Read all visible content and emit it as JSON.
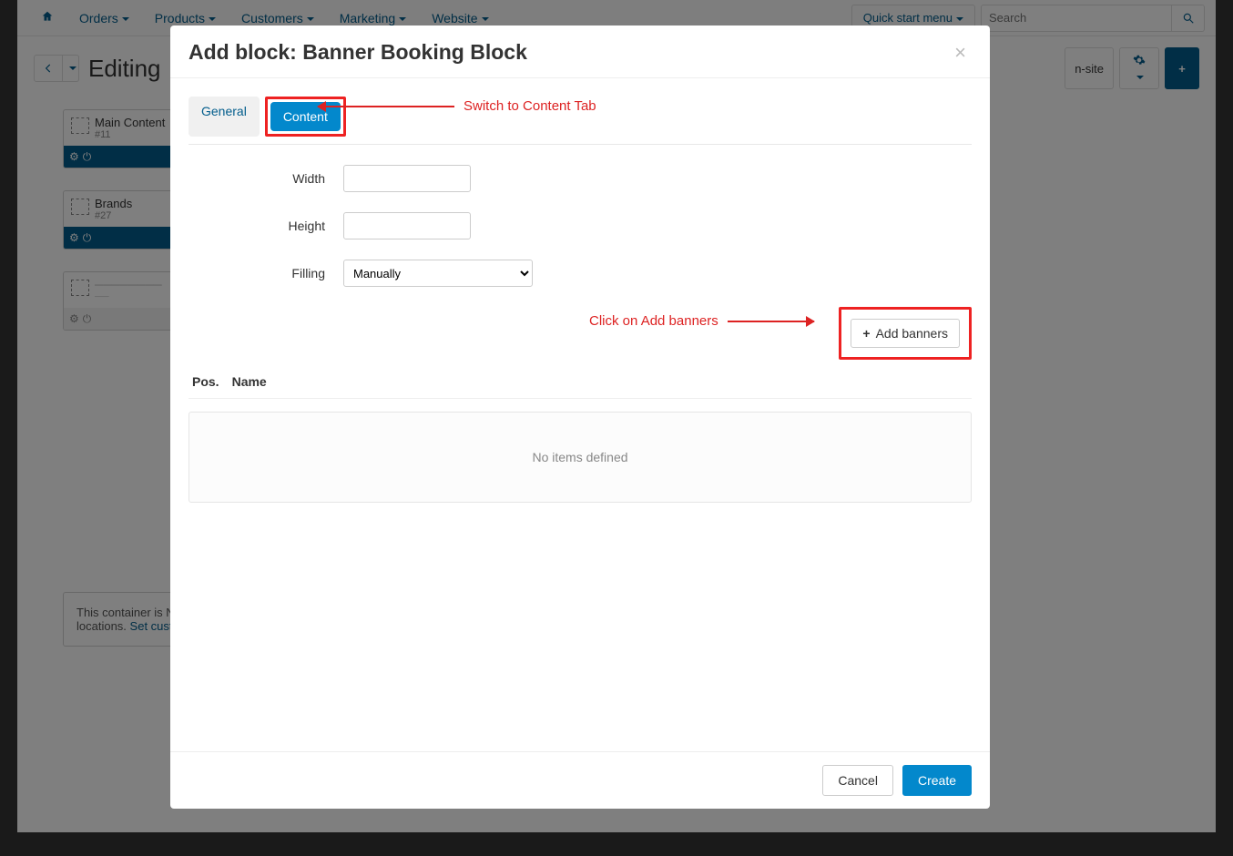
{
  "nav": {
    "orders": "Orders",
    "products": "Products",
    "customers": "Customers",
    "marketing": "Marketing",
    "website": "Website",
    "quickstart": "Quick start menu",
    "search_placeholder": "Search"
  },
  "header": {
    "title": "Editing",
    "onsite": "n-site"
  },
  "sidebar": {
    "items": [
      {
        "title": "Main Content",
        "sub": "#11"
      },
      {
        "title": "Brands",
        "sub": "#27"
      }
    ]
  },
  "note": {
    "line1": "This container is NO",
    "line2": "locations. ",
    "link": "Set custo"
  },
  "modal": {
    "title": "Add block: Banner Booking Block",
    "tabs": {
      "general": "General",
      "content": "Content"
    },
    "form": {
      "width_label": "Width",
      "width_value": "",
      "height_label": "Height",
      "height_value": "",
      "filling_label": "Filling",
      "filling_value": "Manually"
    },
    "addbanners": "Add banners",
    "columns": {
      "pos": "Pos.",
      "name": "Name"
    },
    "empty": "No items defined",
    "cancel": "Cancel",
    "create": "Create"
  },
  "annotations": {
    "switch_tab": "Switch to Content Tab",
    "click_add": "Click on Add banners"
  }
}
